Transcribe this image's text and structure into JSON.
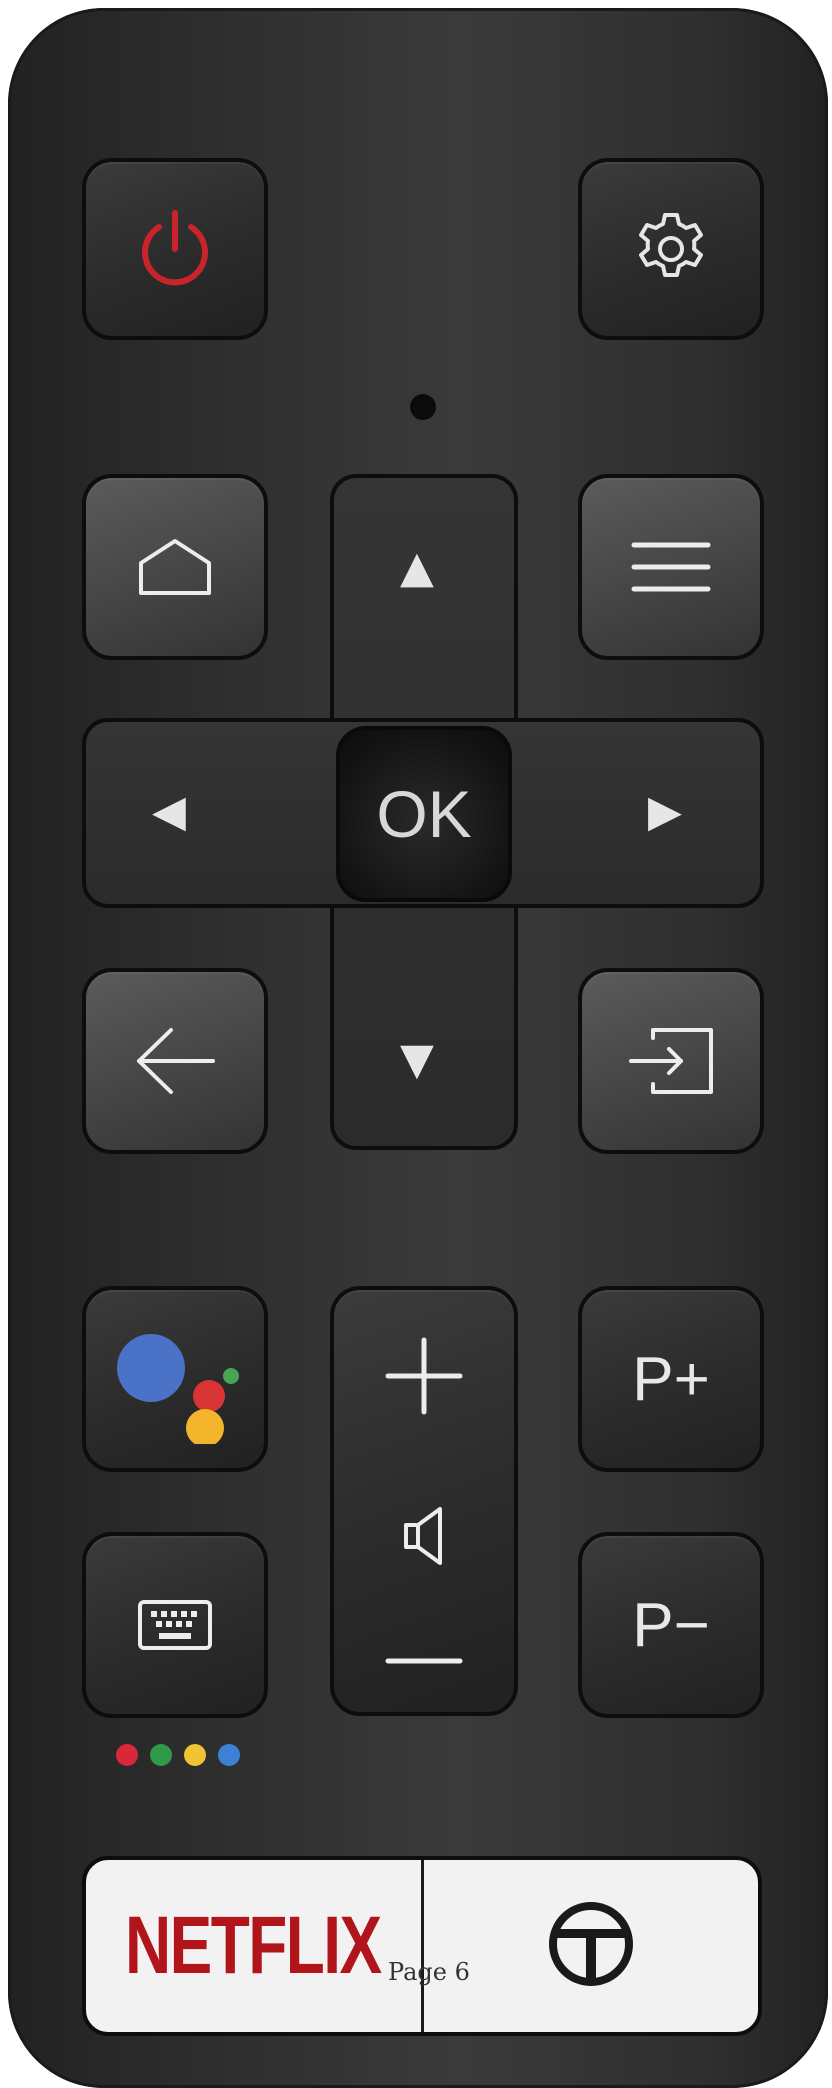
{
  "remote": {
    "buttons": {
      "power": {
        "icon": "power-icon",
        "color": "#c9242c"
      },
      "settings": {
        "icon": "gear-icon"
      },
      "home": {
        "icon": "home-icon"
      },
      "menu": {
        "icon": "menu-lines-icon"
      },
      "up": {
        "label": "▲"
      },
      "left": {
        "label": "◀"
      },
      "ok": {
        "label": "OK"
      },
      "right": {
        "label": "▶"
      },
      "down": {
        "label": "▼"
      },
      "back": {
        "icon": "back-arrow-icon"
      },
      "input": {
        "icon": "input-source-icon"
      },
      "assistant": {
        "icon": "google-assistant-icon"
      },
      "volume": {
        "up_icon": "plus-icon",
        "icon": "speaker-icon",
        "down_icon": "minus-icon"
      },
      "channel_up": {
        "label": "P+"
      },
      "channel_down": {
        "label": "P−"
      },
      "keyboard": {
        "icon": "keyboard-icon"
      }
    },
    "color_dots": [
      "#d8283a",
      "#2e9a4a",
      "#f1c232",
      "#3b82d6"
    ],
    "apps": {
      "netflix": {
        "label": "NETFLIX",
        "color": "#b1151b"
      },
      "tcl": {
        "icon": "tcl-logo-icon"
      }
    }
  },
  "footer": {
    "page_label": "Page 6"
  }
}
